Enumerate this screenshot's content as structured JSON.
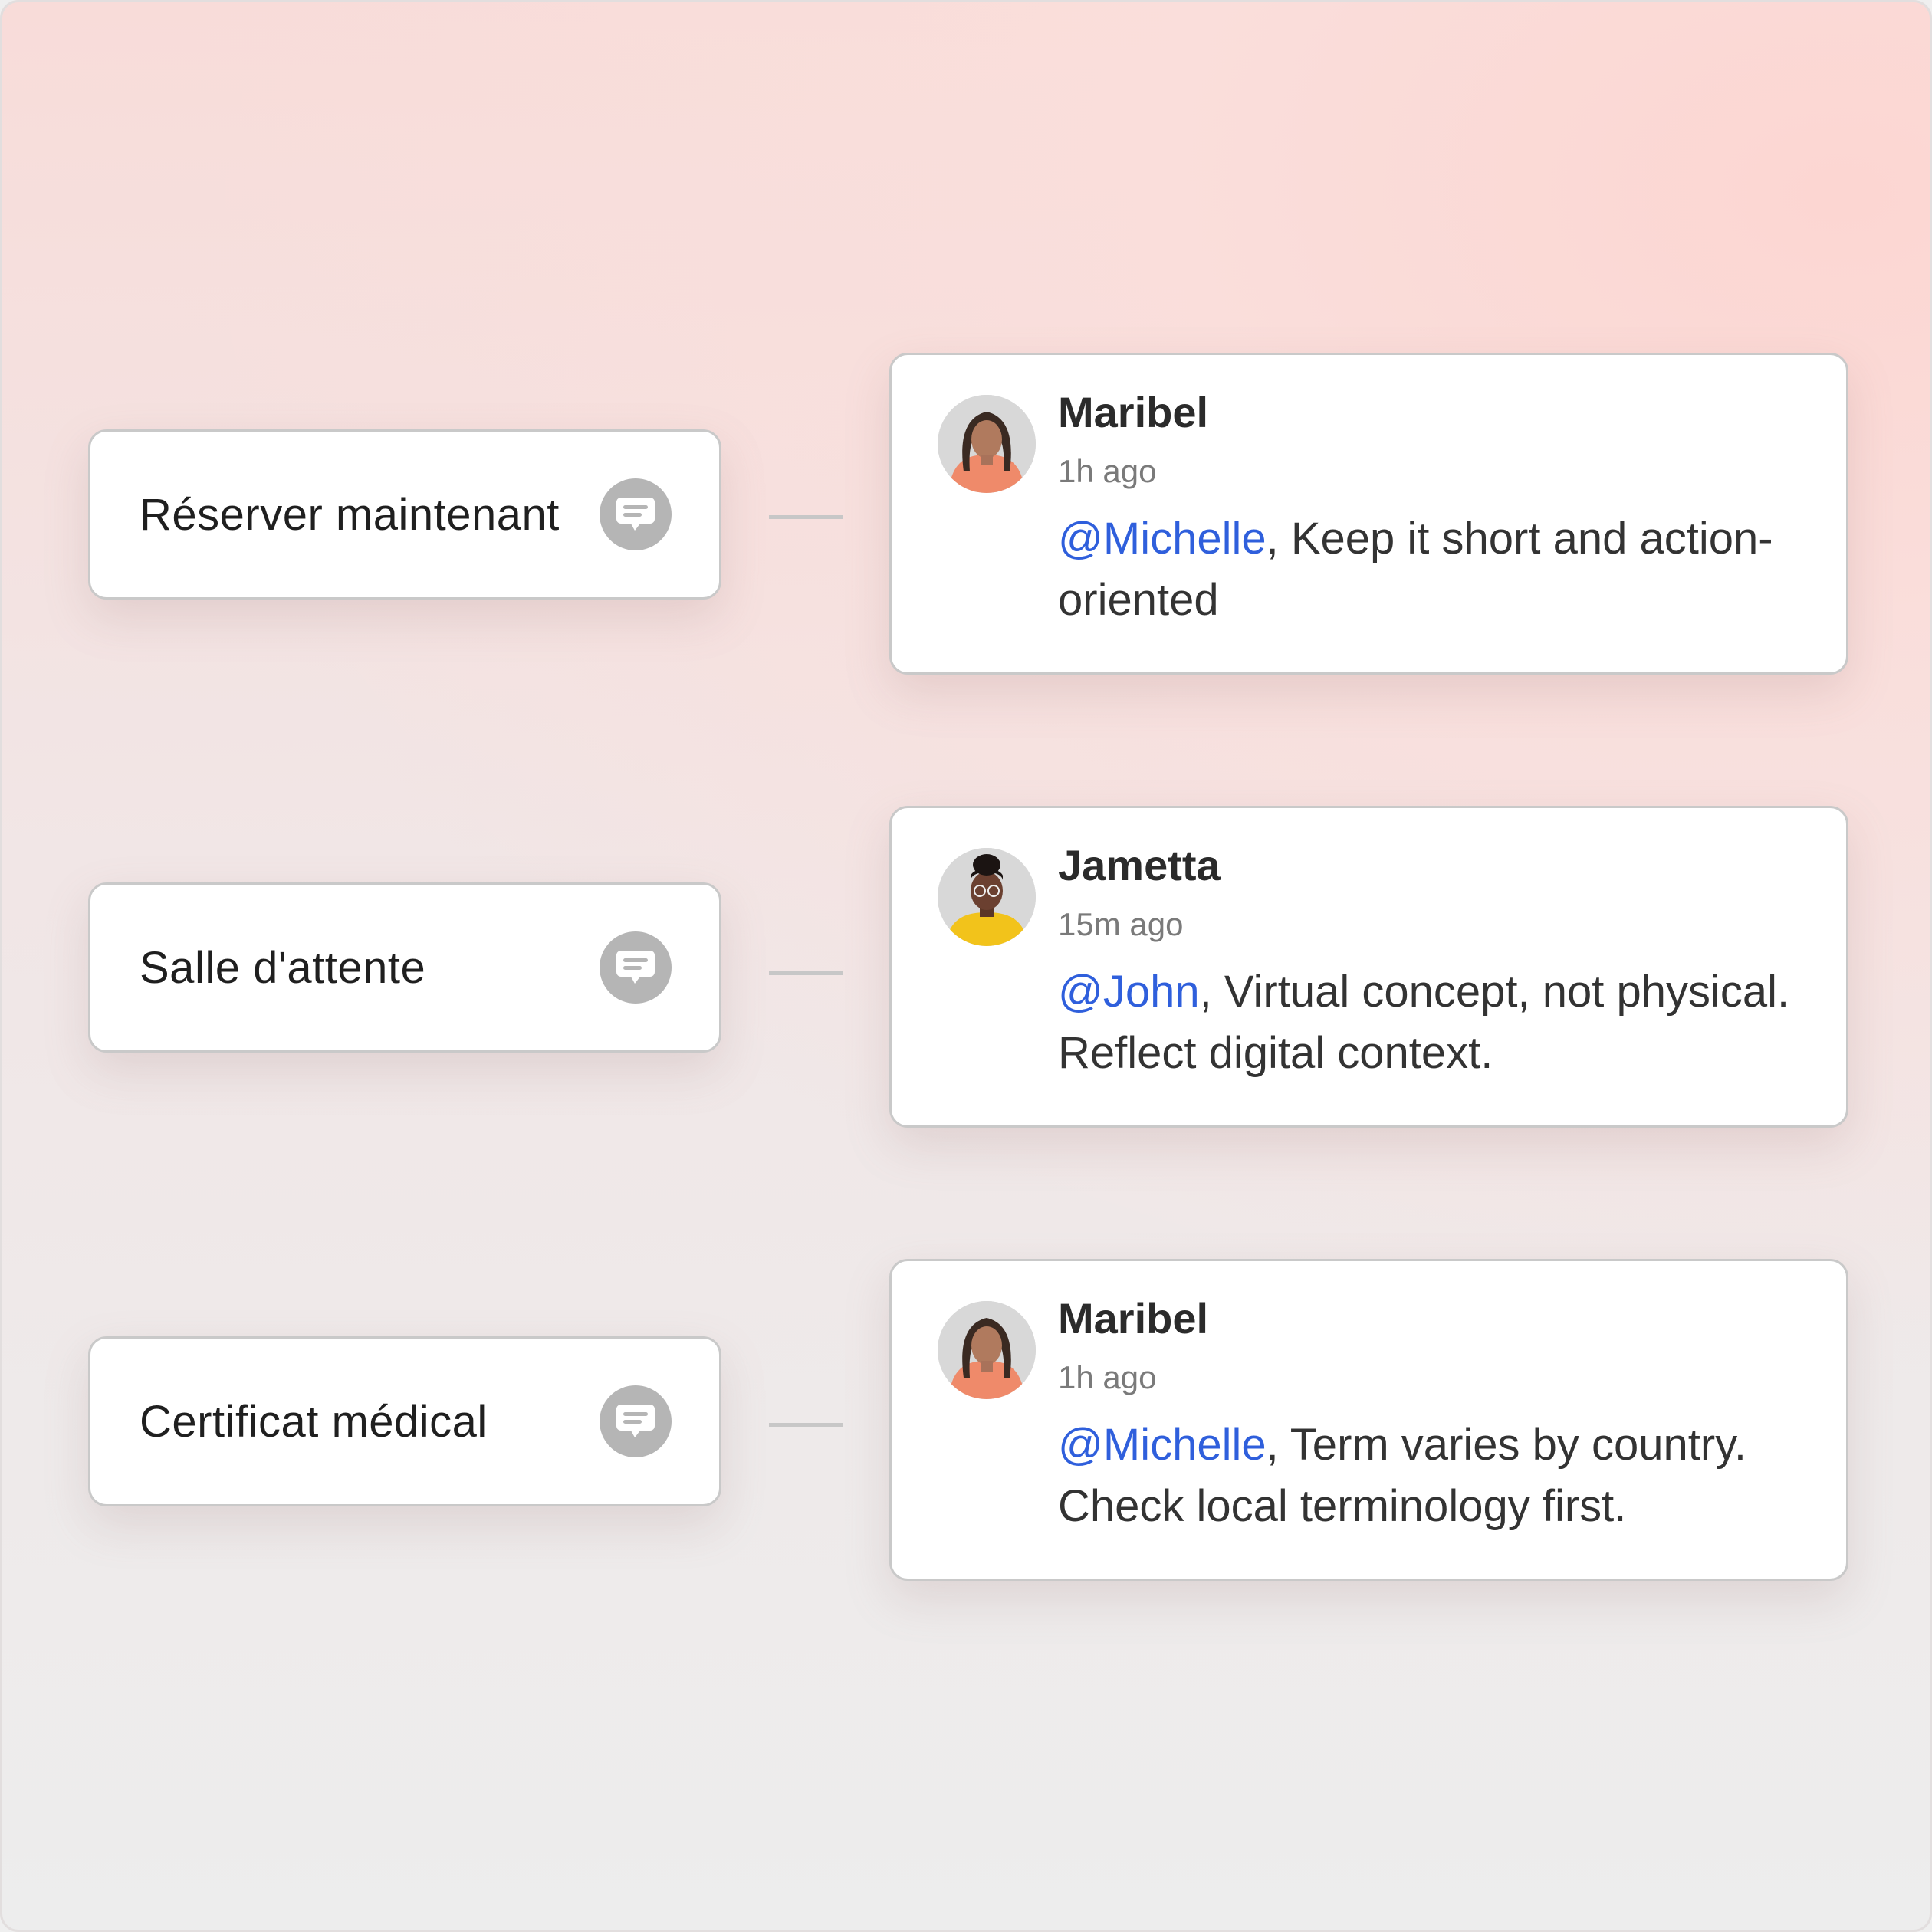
{
  "rows": [
    {
      "term": "Réserver maintenant",
      "comment_icon": "speech-bubble-icon",
      "comment": {
        "author": "Maribel",
        "time": "1h ago",
        "mention": "@Michelle",
        "text": ", Keep it short and action-oriented"
      }
    },
    {
      "term": "Salle d'attente",
      "comment_icon": "speech-bubble-icon",
      "comment": {
        "author": "Jametta",
        "time": "15m ago",
        "mention": "@John",
        "text": ", Virtual concept, not physical. Reflect digital context."
      }
    },
    {
      "term": "Certificat médical",
      "comment_icon": "speech-bubble-icon",
      "comment": {
        "author": "Maribel",
        "time": "1h ago",
        "mention": "@Michelle",
        "text": ", Term varies by country. Check local terminology first."
      }
    }
  ],
  "colors": {
    "mention": "#2f5fdc",
    "icon_bg": "#b5b5b5",
    "border": "#c9c9c9"
  }
}
